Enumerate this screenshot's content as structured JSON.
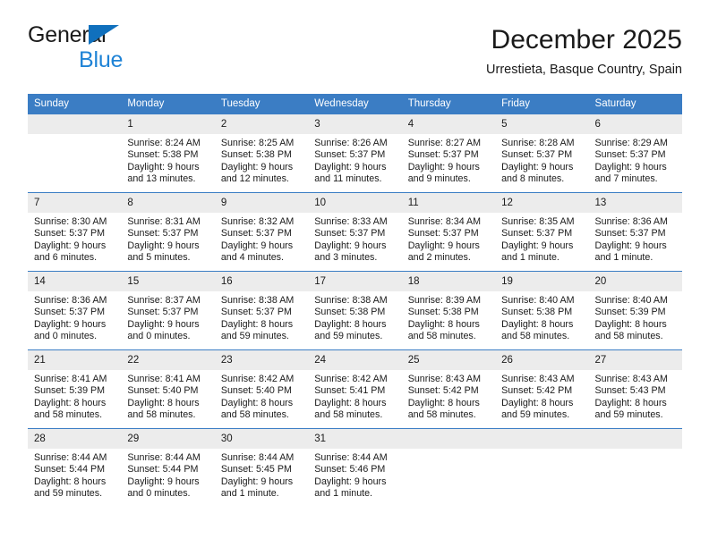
{
  "brand": {
    "line1": "General",
    "line2": "Blue",
    "triangle_color": "#1070bd",
    "blue_text_color": "#1f83d6"
  },
  "header": {
    "month_title": "December 2025",
    "location": "Urrestieta, Basque Country, Spain"
  },
  "calendar": {
    "header_bg": "#3b7dc4",
    "daynum_bg": "#ececec",
    "weekdays": [
      "Sunday",
      "Monday",
      "Tuesday",
      "Wednesday",
      "Thursday",
      "Friday",
      "Saturday"
    ],
    "weeks": [
      [
        {
          "day": "",
          "empty": true,
          "sunrise": "",
          "sunset": "",
          "daylight1": "",
          "daylight2": ""
        },
        {
          "day": "1",
          "empty": false,
          "sunrise": "Sunrise: 8:24 AM",
          "sunset": "Sunset: 5:38 PM",
          "daylight1": "Daylight: 9 hours",
          "daylight2": "and 13 minutes."
        },
        {
          "day": "2",
          "empty": false,
          "sunrise": "Sunrise: 8:25 AM",
          "sunset": "Sunset: 5:38 PM",
          "daylight1": "Daylight: 9 hours",
          "daylight2": "and 12 minutes."
        },
        {
          "day": "3",
          "empty": false,
          "sunrise": "Sunrise: 8:26 AM",
          "sunset": "Sunset: 5:37 PM",
          "daylight1": "Daylight: 9 hours",
          "daylight2": "and 11 minutes."
        },
        {
          "day": "4",
          "empty": false,
          "sunrise": "Sunrise: 8:27 AM",
          "sunset": "Sunset: 5:37 PM",
          "daylight1": "Daylight: 9 hours",
          "daylight2": "and 9 minutes."
        },
        {
          "day": "5",
          "empty": false,
          "sunrise": "Sunrise: 8:28 AM",
          "sunset": "Sunset: 5:37 PM",
          "daylight1": "Daylight: 9 hours",
          "daylight2": "and 8 minutes."
        },
        {
          "day": "6",
          "empty": false,
          "sunrise": "Sunrise: 8:29 AM",
          "sunset": "Sunset: 5:37 PM",
          "daylight1": "Daylight: 9 hours",
          "daylight2": "and 7 minutes."
        }
      ],
      [
        {
          "day": "7",
          "empty": false,
          "sunrise": "Sunrise: 8:30 AM",
          "sunset": "Sunset: 5:37 PM",
          "daylight1": "Daylight: 9 hours",
          "daylight2": "and 6 minutes."
        },
        {
          "day": "8",
          "empty": false,
          "sunrise": "Sunrise: 8:31 AM",
          "sunset": "Sunset: 5:37 PM",
          "daylight1": "Daylight: 9 hours",
          "daylight2": "and 5 minutes."
        },
        {
          "day": "9",
          "empty": false,
          "sunrise": "Sunrise: 8:32 AM",
          "sunset": "Sunset: 5:37 PM",
          "daylight1": "Daylight: 9 hours",
          "daylight2": "and 4 minutes."
        },
        {
          "day": "10",
          "empty": false,
          "sunrise": "Sunrise: 8:33 AM",
          "sunset": "Sunset: 5:37 PM",
          "daylight1": "Daylight: 9 hours",
          "daylight2": "and 3 minutes."
        },
        {
          "day": "11",
          "empty": false,
          "sunrise": "Sunrise: 8:34 AM",
          "sunset": "Sunset: 5:37 PM",
          "daylight1": "Daylight: 9 hours",
          "daylight2": "and 2 minutes."
        },
        {
          "day": "12",
          "empty": false,
          "sunrise": "Sunrise: 8:35 AM",
          "sunset": "Sunset: 5:37 PM",
          "daylight1": "Daylight: 9 hours",
          "daylight2": "and 1 minute."
        },
        {
          "day": "13",
          "empty": false,
          "sunrise": "Sunrise: 8:36 AM",
          "sunset": "Sunset: 5:37 PM",
          "daylight1": "Daylight: 9 hours",
          "daylight2": "and 1 minute."
        }
      ],
      [
        {
          "day": "14",
          "empty": false,
          "sunrise": "Sunrise: 8:36 AM",
          "sunset": "Sunset: 5:37 PM",
          "daylight1": "Daylight: 9 hours",
          "daylight2": "and 0 minutes."
        },
        {
          "day": "15",
          "empty": false,
          "sunrise": "Sunrise: 8:37 AM",
          "sunset": "Sunset: 5:37 PM",
          "daylight1": "Daylight: 9 hours",
          "daylight2": "and 0 minutes."
        },
        {
          "day": "16",
          "empty": false,
          "sunrise": "Sunrise: 8:38 AM",
          "sunset": "Sunset: 5:37 PM",
          "daylight1": "Daylight: 8 hours",
          "daylight2": "and 59 minutes."
        },
        {
          "day": "17",
          "empty": false,
          "sunrise": "Sunrise: 8:38 AM",
          "sunset": "Sunset: 5:38 PM",
          "daylight1": "Daylight: 8 hours",
          "daylight2": "and 59 minutes."
        },
        {
          "day": "18",
          "empty": false,
          "sunrise": "Sunrise: 8:39 AM",
          "sunset": "Sunset: 5:38 PM",
          "daylight1": "Daylight: 8 hours",
          "daylight2": "and 58 minutes."
        },
        {
          "day": "19",
          "empty": false,
          "sunrise": "Sunrise: 8:40 AM",
          "sunset": "Sunset: 5:38 PM",
          "daylight1": "Daylight: 8 hours",
          "daylight2": "and 58 minutes."
        },
        {
          "day": "20",
          "empty": false,
          "sunrise": "Sunrise: 8:40 AM",
          "sunset": "Sunset: 5:39 PM",
          "daylight1": "Daylight: 8 hours",
          "daylight2": "and 58 minutes."
        }
      ],
      [
        {
          "day": "21",
          "empty": false,
          "sunrise": "Sunrise: 8:41 AM",
          "sunset": "Sunset: 5:39 PM",
          "daylight1": "Daylight: 8 hours",
          "daylight2": "and 58 minutes."
        },
        {
          "day": "22",
          "empty": false,
          "sunrise": "Sunrise: 8:41 AM",
          "sunset": "Sunset: 5:40 PM",
          "daylight1": "Daylight: 8 hours",
          "daylight2": "and 58 minutes."
        },
        {
          "day": "23",
          "empty": false,
          "sunrise": "Sunrise: 8:42 AM",
          "sunset": "Sunset: 5:40 PM",
          "daylight1": "Daylight: 8 hours",
          "daylight2": "and 58 minutes."
        },
        {
          "day": "24",
          "empty": false,
          "sunrise": "Sunrise: 8:42 AM",
          "sunset": "Sunset: 5:41 PM",
          "daylight1": "Daylight: 8 hours",
          "daylight2": "and 58 minutes."
        },
        {
          "day": "25",
          "empty": false,
          "sunrise": "Sunrise: 8:43 AM",
          "sunset": "Sunset: 5:42 PM",
          "daylight1": "Daylight: 8 hours",
          "daylight2": "and 58 minutes."
        },
        {
          "day": "26",
          "empty": false,
          "sunrise": "Sunrise: 8:43 AM",
          "sunset": "Sunset: 5:42 PM",
          "daylight1": "Daylight: 8 hours",
          "daylight2": "and 59 minutes."
        },
        {
          "day": "27",
          "empty": false,
          "sunrise": "Sunrise: 8:43 AM",
          "sunset": "Sunset: 5:43 PM",
          "daylight1": "Daylight: 8 hours",
          "daylight2": "and 59 minutes."
        }
      ],
      [
        {
          "day": "28",
          "empty": false,
          "sunrise": "Sunrise: 8:44 AM",
          "sunset": "Sunset: 5:44 PM",
          "daylight1": "Daylight: 8 hours",
          "daylight2": "and 59 minutes."
        },
        {
          "day": "29",
          "empty": false,
          "sunrise": "Sunrise: 8:44 AM",
          "sunset": "Sunset: 5:44 PM",
          "daylight1": "Daylight: 9 hours",
          "daylight2": "and 0 minutes."
        },
        {
          "day": "30",
          "empty": false,
          "sunrise": "Sunrise: 8:44 AM",
          "sunset": "Sunset: 5:45 PM",
          "daylight1": "Daylight: 9 hours",
          "daylight2": "and 1 minute."
        },
        {
          "day": "31",
          "empty": false,
          "sunrise": "Sunrise: 8:44 AM",
          "sunset": "Sunset: 5:46 PM",
          "daylight1": "Daylight: 9 hours",
          "daylight2": "and 1 minute."
        },
        {
          "day": "",
          "empty": true,
          "sunrise": "",
          "sunset": "",
          "daylight1": "",
          "daylight2": ""
        },
        {
          "day": "",
          "empty": true,
          "sunrise": "",
          "sunset": "",
          "daylight1": "",
          "daylight2": ""
        },
        {
          "day": "",
          "empty": true,
          "sunrise": "",
          "sunset": "",
          "daylight1": "",
          "daylight2": ""
        }
      ]
    ]
  }
}
